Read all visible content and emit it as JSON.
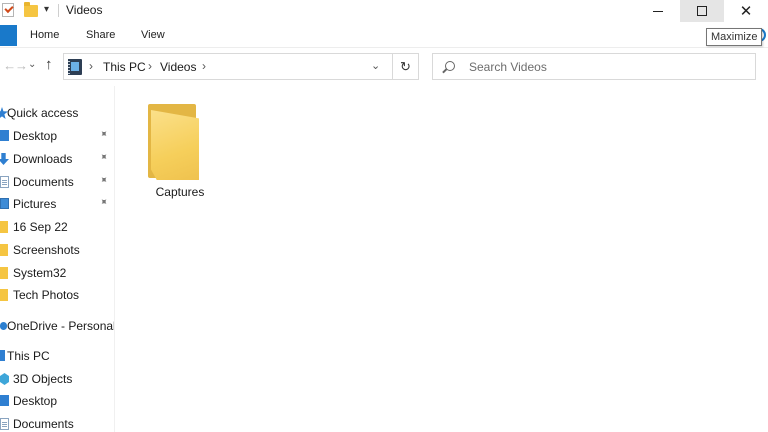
{
  "window": {
    "title": "Videos",
    "quick_access_dropdown": "▾",
    "minimize_label": "",
    "close_symbol": "✕",
    "tooltip": "Maximize"
  },
  "ribbon": {
    "tabs": [
      "Home",
      "Share",
      "View"
    ]
  },
  "navigation": {
    "back_symbol": "→",
    "forward_symbol": "→",
    "recent_symbol": "⌄",
    "up_symbol": "↑",
    "breadcrumb": [
      "This PC",
      "Videos"
    ],
    "separator": "›",
    "dropdown_symbol": "⌄",
    "refresh_symbol": "↻"
  },
  "search": {
    "placeholder": "Search Videos",
    "value": ""
  },
  "sidebar": {
    "items": [
      {
        "label": "Quick access",
        "icon": "star-icon",
        "pinned": false
      },
      {
        "label": "Desktop",
        "icon": "desktop-icon",
        "pinned": true
      },
      {
        "label": "Downloads",
        "icon": "downloads-icon",
        "pinned": true
      },
      {
        "label": "Documents",
        "icon": "documents-icon",
        "pinned": true
      },
      {
        "label": "Pictures",
        "icon": "pictures-icon",
        "pinned": true
      },
      {
        "label": "16 Sep 22",
        "icon": "folder-icon",
        "pinned": false
      },
      {
        "label": "Screenshots",
        "icon": "folder-icon",
        "pinned": false
      },
      {
        "label": "System32",
        "icon": "folder-icon",
        "pinned": false
      },
      {
        "label": "Tech Photos",
        "icon": "folder-icon",
        "pinned": false
      },
      {
        "label": "OneDrive - Personal",
        "icon": "cloud-icon",
        "pinned": false
      },
      {
        "label": "This PC",
        "icon": "pc-icon",
        "pinned": false
      },
      {
        "label": "3D Objects",
        "icon": "3d-objects-icon",
        "pinned": false
      },
      {
        "label": "Desktop",
        "icon": "desktop-icon",
        "pinned": false
      },
      {
        "label": "Documents",
        "icon": "documents-icon",
        "pinned": false
      }
    ],
    "pin_symbol": "📌"
  },
  "content": {
    "items": [
      {
        "name": "Captures",
        "type": "folder"
      }
    ]
  },
  "colors": {
    "accent": "#1979ca",
    "folder": "#f5c542",
    "hover": "#e5e5e5"
  }
}
